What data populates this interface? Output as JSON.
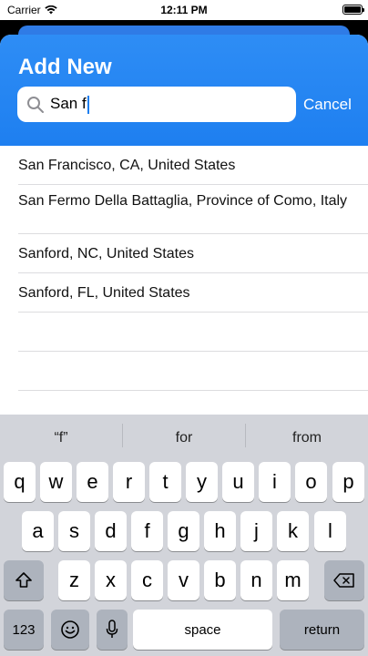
{
  "status_bar": {
    "carrier": "Carrier",
    "time": "12:11 PM"
  },
  "sheet": {
    "title": "Add New",
    "search": {
      "value": "San f",
      "icon": "search-icon"
    },
    "cancel_label": "Cancel"
  },
  "results": [
    "San Francisco, CA, United States",
    "San Fermo Della Battaglia, Province of Como, Italy",
    "Sanford, NC, United States",
    "Sanford, FL, United States"
  ],
  "keyboard": {
    "predictions": [
      "“f”",
      "for",
      "from"
    ],
    "row1": [
      "q",
      "w",
      "e",
      "r",
      "t",
      "y",
      "u",
      "i",
      "o",
      "p"
    ],
    "row2": [
      "a",
      "s",
      "d",
      "f",
      "g",
      "h",
      "j",
      "k",
      "l"
    ],
    "row3": [
      "z",
      "x",
      "c",
      "v",
      "b",
      "n",
      "m"
    ],
    "numbers_label": "123",
    "space_label": "space",
    "return_label": "return"
  },
  "colors": {
    "accent": "#1e7ff0",
    "keyboard_bg": "#d2d4da"
  }
}
